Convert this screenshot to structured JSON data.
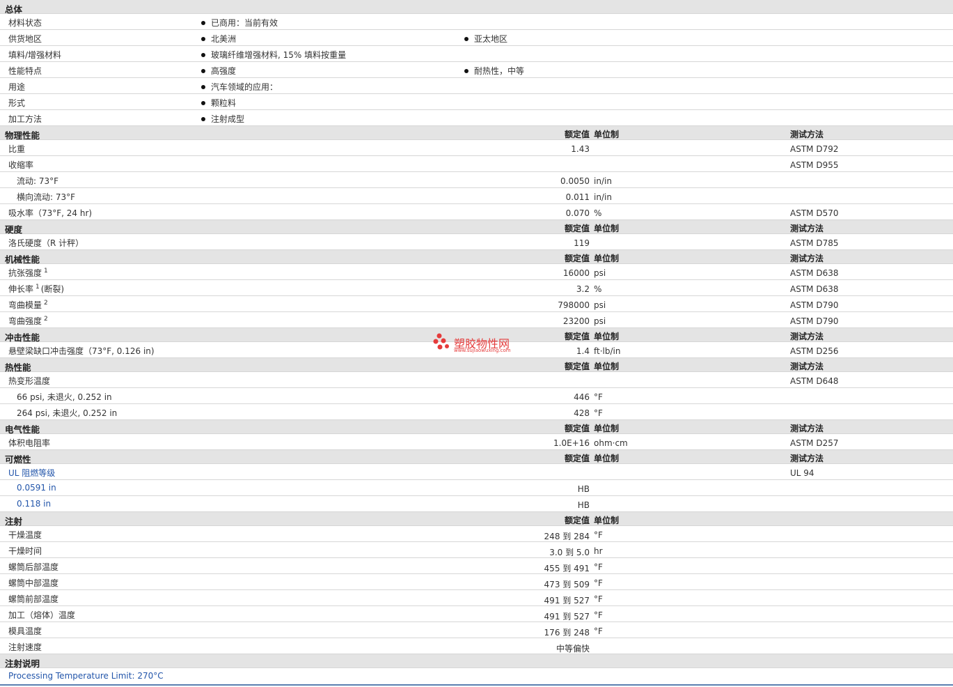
{
  "general": {
    "title": "总体",
    "rows": [
      {
        "label": "材料状态",
        "b1": "已商用：当前有效",
        "b2": ""
      },
      {
        "label": "供货地区",
        "b1": "北美洲",
        "b2": "亚太地区"
      },
      {
        "label": "填料/增强材料",
        "b1": "玻璃纤维增强材料, 15% 填料按重量",
        "b2": ""
      },
      {
        "label": "性能特点",
        "b1": "高强度",
        "b2": "耐热性，中等"
      },
      {
        "label": "用途",
        "b1": "汽车领域的应用：",
        "b2": ""
      },
      {
        "label": "形式",
        "b1": "颗粒料",
        "b2": ""
      },
      {
        "label": "加工方法",
        "b1": "注射成型",
        "b2": ""
      }
    ]
  },
  "headers": {
    "value": "额定值",
    "unit": "单位制",
    "test": "测试方法"
  },
  "physical": {
    "title": "物理性能",
    "rows": [
      {
        "label": "比重",
        "value": "1.43",
        "unit": "",
        "test": "ASTM D792"
      },
      {
        "label": "收缩率",
        "value": "",
        "unit": "",
        "test": "ASTM D955"
      },
      {
        "label": "流动: 73°F",
        "value": "0.0050",
        "unit": "in/in",
        "test": ""
      },
      {
        "label": "横向流动: 73°F",
        "value": "0.011",
        "unit": "in/in",
        "test": ""
      },
      {
        "label": "吸水率（73°F, 24 hr)",
        "value": "0.070",
        "unit": "%",
        "test": "ASTM D570"
      }
    ]
  },
  "hardness": {
    "title": "硬度",
    "rows": [
      {
        "label": "洛氏硬度（R 计秤）",
        "value": "119",
        "unit": "",
        "test": "ASTM D785"
      }
    ]
  },
  "mechanical": {
    "title": "机械性能",
    "rows": [
      {
        "label": "抗张强度",
        "sup": "1",
        "suffix": "",
        "value": "16000",
        "unit": "psi",
        "test": "ASTM D638"
      },
      {
        "label": "伸长率",
        "sup": "1",
        "suffix": "(断裂)",
        "value": "3.2",
        "unit": "%",
        "test": "ASTM D638"
      },
      {
        "label": "弯曲模量",
        "sup": "2",
        "suffix": "",
        "value": "798000",
        "unit": "psi",
        "test": "ASTM D790"
      },
      {
        "label": "弯曲强度",
        "sup": "2",
        "suffix": "",
        "value": "23200",
        "unit": "psi",
        "test": "ASTM D790"
      }
    ]
  },
  "impact": {
    "title": "冲击性能",
    "rows": [
      {
        "label": "悬壁梁缺口冲击强度（73°F, 0.126 in)",
        "value": "1.4",
        "unit": "ft·lb/in",
        "test": "ASTM D256"
      }
    ]
  },
  "thermal": {
    "title": "热性能",
    "rows": [
      {
        "label": "热变形温度",
        "value": "",
        "unit": "",
        "test": "ASTM D648"
      },
      {
        "label": "66 psi, 未退火, 0.252 in",
        "value": "446",
        "unit": "°F",
        "test": ""
      },
      {
        "label": "264 psi, 未退火, 0.252 in",
        "value": "428",
        "unit": "°F",
        "test": ""
      }
    ]
  },
  "electrical": {
    "title": "电气性能",
    "rows": [
      {
        "label": "体积电阻率",
        "value": "1.0E+16",
        "unit": "ohm·cm",
        "test": "ASTM D257"
      }
    ]
  },
  "flammability": {
    "title": "可燃性",
    "rows": [
      {
        "label": "UL 阻燃等级",
        "value": "",
        "unit": "",
        "test": "UL 94"
      },
      {
        "label": "0.0591 in",
        "value": "HB",
        "unit": "",
        "test": ""
      },
      {
        "label": "0.118 in",
        "value": "HB",
        "unit": "",
        "test": ""
      }
    ]
  },
  "injection": {
    "title": "注射",
    "rows": [
      {
        "label": "干燥温度",
        "value": "248 到  284",
        "unit": "°F"
      },
      {
        "label": "干燥时间",
        "value": "3.0 到  5.0",
        "unit": "hr"
      },
      {
        "label": "螺筒后部温度",
        "value": "455 到  491",
        "unit": "°F"
      },
      {
        "label": "螺筒中部温度",
        "value": "473 到  509",
        "unit": "°F"
      },
      {
        "label": "螺筒前部温度",
        "value": "491 到  527",
        "unit": "°F"
      },
      {
        "label": "加工（熔体）温度",
        "value": "491 到  527",
        "unit": "°F"
      },
      {
        "label": "模具温度",
        "value": "176 到  248",
        "unit": "°F"
      },
      {
        "label": "注射速度",
        "value": "中等偏快",
        "unit": ""
      }
    ]
  },
  "notes": {
    "title": "注射说明",
    "text": "Processing Temperature Limit: 270°C"
  },
  "watermark": {
    "name": "塑胶物性网",
    "url": "www.sujiaowuxing.com"
  },
  "colors": {
    "header_bg": "#e4e4e4",
    "row_border": "#d6d6d6",
    "watermark": "#e53b3b",
    "bottom_rule": "#5a7fb0"
  }
}
